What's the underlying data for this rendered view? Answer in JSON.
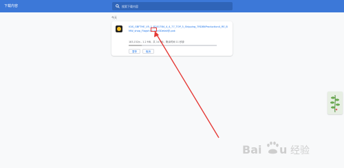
{
  "header": {
    "title": "下载内容",
    "search_placeholder": "搜索下载内容"
  },
  "downloads": {
    "date_label": "今天",
    "items": [
      {
        "file_name": "IGIS_GBFTHE_V5_1_R2017B4_4_4_77_TOP_5_Shipping_7RD8NProduction4_RE_BMW_shop_Flagship1.exe3Detail@.pak",
        "status": "183,152/s - 1.2 MB，共 14 MB，剩余时间 11 秒钟",
        "progress": 0.15,
        "buttons": {
          "pause": "暂停",
          "cancel": "取消"
        }
      }
    ]
  },
  "watermark": {
    "text": "Baidu 经验"
  },
  "colors": {
    "topbar": "#3c78d8",
    "link": "#1a73e8",
    "annotation": "#e53935"
  }
}
